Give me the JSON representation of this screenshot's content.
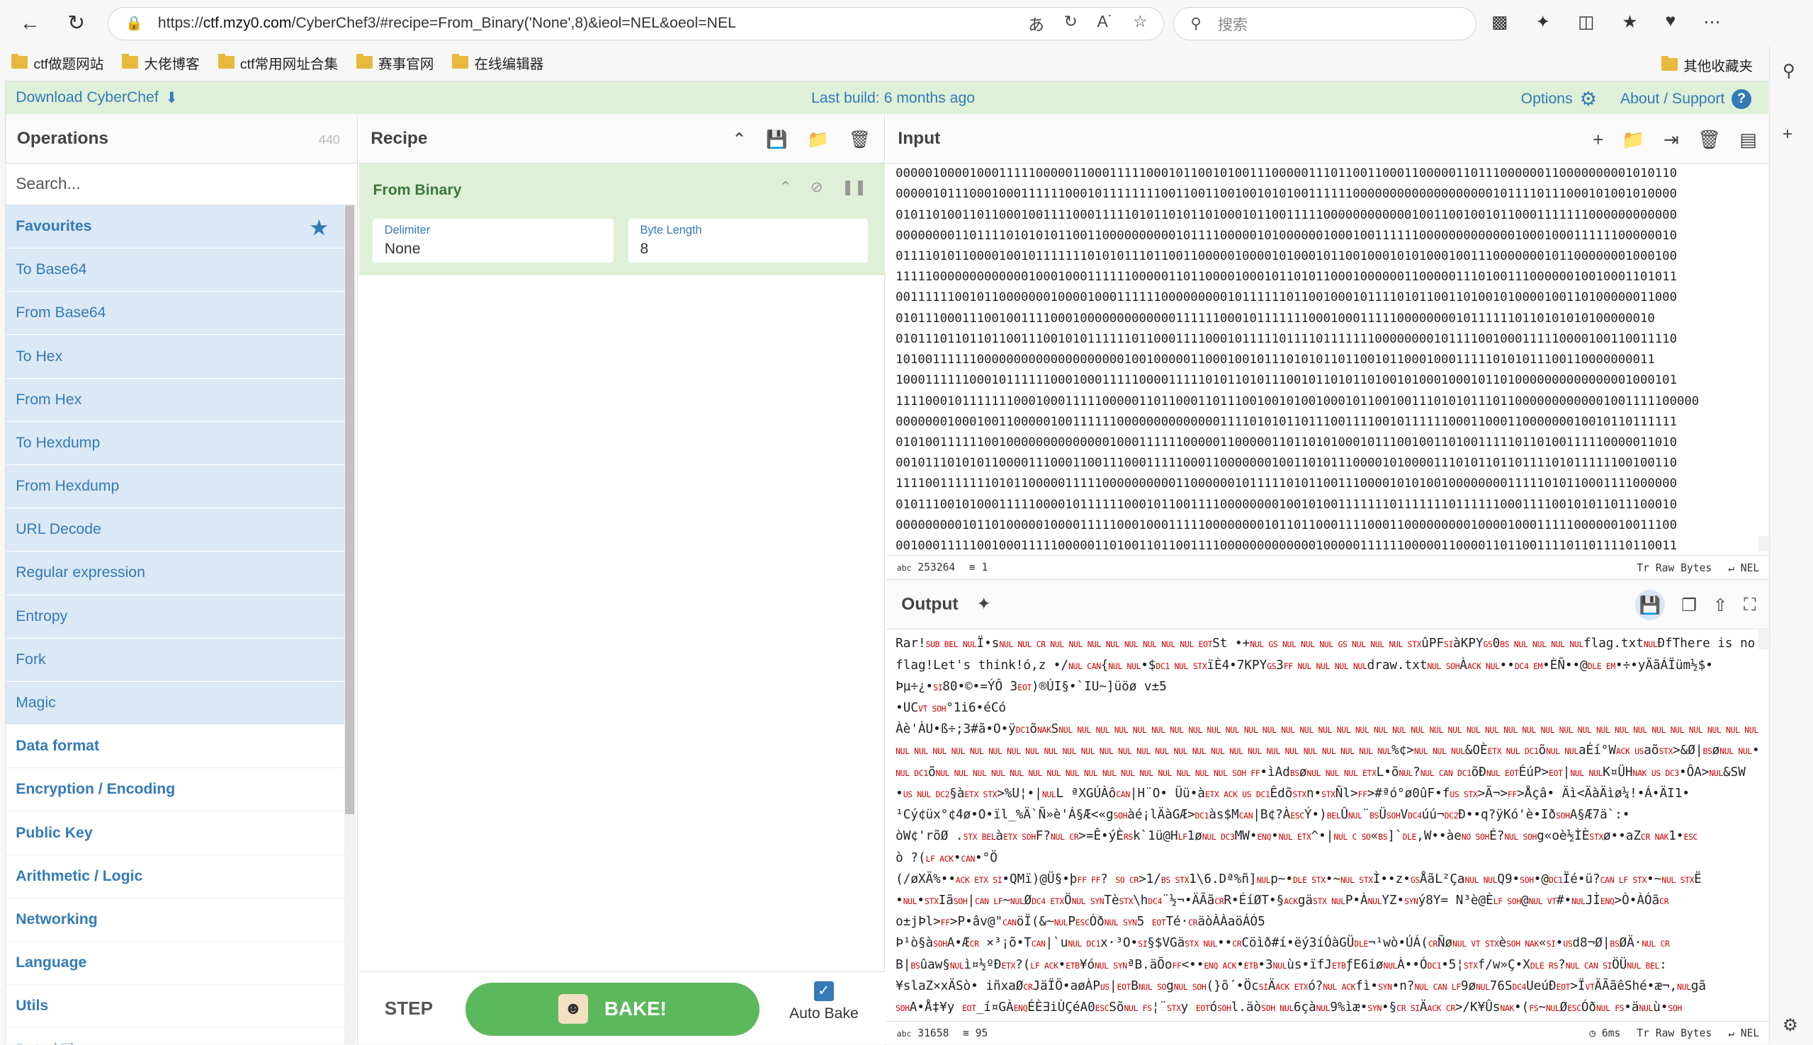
{
  "browser": {
    "url_prefix": "https://",
    "url_host": "ctf.mzy0.com",
    "url_rest": "/CyberChef3/#recipe=From_Binary('None',8)&ieol=NEL&oeol=NEL",
    "search_placeholder": "搜索",
    "bookmarks": [
      "ctf做题网站",
      "大佬博客",
      "ctf常用网址合集",
      "赛事官网",
      "在线编辑器"
    ],
    "other_bookmarks": "其他收藏夹"
  },
  "banner": {
    "download": "Download CyberChef",
    "last_build": "Last build: 6 months ago",
    "options": "Options",
    "about": "About / Support"
  },
  "operations": {
    "title": "Operations",
    "count": "440",
    "search_placeholder": "Search...",
    "favourites": "Favourites",
    "fav_items": [
      "To Base64",
      "From Base64",
      "To Hex",
      "From Hex",
      "To Hexdump",
      "From Hexdump",
      "URL Decode",
      "Regular expression",
      "Entropy",
      "Fork",
      "Magic"
    ],
    "categories": [
      "Data format",
      "Encryption / Encoding",
      "Public Key",
      "Arithmetic / Logic",
      "Networking",
      "Language",
      "Utils",
      "Date / Time"
    ]
  },
  "recipe": {
    "title": "Recipe",
    "op_name": "From Binary",
    "delimiter_label": "Delimiter",
    "delimiter_value": "None",
    "bytelen_label": "Byte Length",
    "bytelen_value": "8",
    "step": "STEP",
    "bake": "BAKE!",
    "autobake": "Auto Bake"
  },
  "input": {
    "title": "Input",
    "lines": [
      "0000010000100011111000001100011111000101100101001110000011101100110001100000110111000000110000000001010110",
      "0000010111000100011111100010111111110011001100100101010011111100000000000000000001011110111000101001010000",
      "0101101001101100010011110001111101011010110100010110011111000000000000100110010010110001111111000000000000",
      "0000000011011110101010110011000000000010111100000101000000100010011111100000000000001000100011111100000010",
      "0111101011000010010111111101010111011001100000100001010001011001000101010001001110000000101100000001000100",
      "1111100000000000001000100011111100000110110000100010110101100010000001100000111010011100000010010001101011",
      "0011111100101100000001000010001111110000000001011111101100100010111101011001101001010000100110100000011000",
      "0101110001110010011110001000000000000011111100010111111100010001111100000000101111110110101010100000010",
      "0101110110110110011100101011111101100011110001011111011110111111100000000101111001000111110000100110011110",
      "1010011111100000000000000000000100100000110001001011101010110110010110001000111110101011100110000000011",
      "1000111111000101111110001000111110000111110101101011100101101011010010100010001011010000000000000001000101",
      "1111000101111111000100011111000001101100011011100100101001000101100100111010101110110000000000001001111100000",
      "0000000100010011000001001111110000000000000011110101011011100111100101111110001100011000000010010110111111",
      "0101001111110010000000000000010001111110000011000001101101010001011100100110100111110110100111110000011010",
      "0010111010101100001110001100111000111110001100000001001101011100001010000111010110110111101011111100100110",
      "1111001111111010110000011111000000000011000000101111101011001110000101010010000000011111010110001111000000",
      "0101110010100011111000010111111000101100111100000000100101001111111011111110111111000111100101011011100010",
      "0000000001011010000010000111110001000111110000000010110110001111000110000000001000010001111100000010011100",
      "0010001111100100011111000001101001101100111100000000000001000001111110000011000011011001111011011110110011"
    ],
    "status_chars": "253264",
    "status_lines": "1",
    "raw_bytes": "Raw Bytes",
    "eol": "NEL"
  },
  "output": {
    "title": "Output",
    "lines": [
      "Rar!⟨SUB BEL NUL⟩Ï•s⟨NUL NUL CR NUL NUL NUL NUL NUL NUL NUL NUL EOT⟩St •+⟨NUL GS NUL NUL NUL GS NUL NUL NUL STX⟩ûPF⟨SI⟩àKPY⟨GS⟩0⟨BS NUL  NUL NUL NUL⟩flag.txt⟨NUL⟩ÐfThere is no",
      "flag!Let's think!ó,z •/⟨NUL CAN⟩{⟨NUL NUL⟩•$⟨DC1 NUL STX⟩ïÈ4•7KPY⟨GS⟩3⟨FF NUL  NUL NUL NUL⟩draw.txt⟨NUL SOH⟩À⟨ACK NUL⟩••⟨DC4 EM⟩•ÈÑ••@⟨DLE EM⟩•÷•yÄãÁÏüm½$•",
      "Þµ÷¿•⟨SI⟩80•©•=ÝÔ 3⟨EOT⟩)®ÚI§•`IU~]üöø   v±5",
      "•UC⟨VT SOH⟩°1i6•éCó",
      "Àè'ÀU•ß÷;3#ã•O•ÿ⟨DC1⟩õ⟨NAK⟩S⟨NUL NUL NUL NUL NUL NUL NUL NUL NUL NUL NUL NUL NUL NUL NUL NUL NUL NUL NUL NUL NUL NUL NUL NUL NUL NUL NUL NUL NUL NUL NUL NUL NUL NUL NUL NUL NUL NUL⟩",
      "⟨NUL NUL NUL NUL NUL NUL NUL NUL NUL NUL NUL NUL NUL NUL NUL NUL NUL NUL NUL NUL NUL NUL NUL NUL NUL NUL NUL⟩%¢>⟨NUL NUL NUL⟩&OÈ⟨ETX NUL DC1⟩õ⟨NUL NUL⟩aÉí°W⟨ACK US⟩aõ⟨STX⟩>&Ø|⟨BS⟩ø⟨NUL NUL⟩•?",
      "⟨NUL DC1⟩õ⟨NUL NUL NUL NUL NUL NUL NUL NUL NUL NUL NUL NUL NUL NUL NUL NUL SOH FF⟩•ìAd⟨BS⟩ø⟨NUL NUL NUL ETX⟩L•õ⟨NUL⟩?⟨NUL CAN DC1⟩õÐ⟨NUL EOT⟩ÉúP>⟨EOT⟩|⟨NUL NUL⟩K¤ÜH⟨NAK US DC3⟩•ÔA>⟨NUL⟩&SW",
      "•⟨US NUL DC2⟩§à⟨ETX STX⟩>%U¦•|⟨NUL⟩L ªXGÚÀô⟨CAN⟩|H¨O•  Üü•à⟨ETX ACK US DC1⟩Êdõ⟨STX⟩n•⟨STX⟩Ñl>⟨FF⟩>#ªó°ø0ûF•f⟨US STX⟩>Ã¬>⟨FF⟩>Åçâ• Äì<ÄàÄìø¼!•Á•ÄI1•",
      "¹Cý¢üx°¢4ø•O•ïl_%Ä`Ñ»è'Á§Æ<«g⟨SOH⟩àé¡lÄàGÆ>⟨DC1⟩às$M⟨CAN⟩|B¢?À⟨ESC⟩Ý•)⟨BEL⟩Û⟨NUL⟩¨⟨BS⟩Ü⟨SOH⟩V⟨DC4⟩úú¬⟨DC2⟩Ð••q?ÿKó'è•Ið⟨SOH⟩A§Æ7ä`:•",
      "òW¢'rõØ .⟨STX BEL⟩à⟨ETX SOH⟩F?⟨NUL CR⟩>=Ê•ýÈ⟨RS⟩k`1ü@H⟨LF⟩1ø⟨NUL DC3⟩MW•⟨ENQ⟩•⟨NUL ETX⟩^•|⟨NUL C SO⟩«⟨BS⟩]`⟨DLE⟩,W••àe⟨NO SOH⟩É?⟨NUL SOH⟩g«oè½ÌÈ⟨STX⟩ø••aZ⟨CR NAK⟩1•⟨ESC⟩",
      "ò   ?(⟨LF ACK⟩•⟨CAN⟩•°Ö",
      "(/øXÄ%••⟨ACK ETX SI⟩•QMï)@Ü§•þ⟨FF FF⟩?  ⟨SO CR⟩>1/⟨BS STX⟩1\\6.Dª%ñ]⟨NUL⟩p~•⟨DLE STX⟩•~⟨NUL STX⟩Ì••z•⟨GS⟩ÅãL²Ça⟨NUL NUL⟩Q9•⟨SOH⟩•@⟨DC1⟩Ïé•ü?⟨CAN LF STX⟩•~⟨NUL STX⟩Ë",
      "•⟨NUL⟩•⟨STX⟩Iã⟨SOH⟩|⟨CAN LF⟩~⟨NUL⟩Ø⟨DC4 ETX⟩Ö⟨NUL SYN⟩Tè⟨STX⟩\\h⟨DC4⟩¨½¬•ÄÃã⟨CR⟩R•ÉíØT•§⟨ACK⟩gä⟨STX NUL⟩P•À⟨NUL⟩YZ•⟨SYN⟩ý8Y= N³è@È⟨LF SOH⟩@⟨NUL VT⟩#•⟨NUL⟩JÌ⟨ENQ⟩>Ò•ÀÓã⟨CR⟩",
      "o±jÞl>⟨FF⟩>P•âv@\"⟨CAN⟩öÏ(&~⟨NUL⟩P⟨ESC⟩Óð⟨NUL SYN⟩5  ⟨EOT⟩Té·⟨CR⟩äòÀÀaöÁÓ5",
      "Þ¹ò§à⟨SOH⟩A•Æ⟨CR⟩  ×³¡õ•T⟨CAN⟩|`u⟨NUL DC1⟩x·³O•⟨SI⟩§$VGä⟨STX NUL⟩••⟨CR⟩Cöìð#í•ëý3íÓàGÜ⟨DLE⟩¬¹wò•ÚÁ(⟨CR⟩Ñø⟨NUL VT STX⟩è⟨SOH NAK⟩«⟨SI⟩•⟨US⟩d8¬Ø|⟨BS⟩ØÄ·⟨NUL CR⟩",
      "B|⟨BS⟩ûaw§⟨NUL⟩ì¤½ºÐ⟨ETX⟩?(⟨LF ACK⟩•⟨ETB⟩¥ó⟨NUL SYN⟩ªB.äÕo⟨FF⟩<••⟨ENQ ACK⟩•⟨ETB⟩•3⟨NUL⟩ùs•ïfJ⟨ETB⟩ƒE6iø⟨NUL⟩À••Ó⟨DC1⟩•5¦⟨STX⟩f/w»Ç•X⟨DLE RS⟩?⟨NUL CAN SI⟩ÖÜ⟨NUL BEL⟩:",
      "¥slaZ×xÄSò• iñxaØ⟨CR⟩JäÏÖ•aøÀP⟨US⟩|⟨EOT⟩B⟨NUL SO⟩g⟨NUL SOH⟩(}õ´•Öc⟨SI⟩Ä⟨ACK ETX⟩ó?⟨NUL ACK⟩fì•⟨SYN⟩•n?⟨NUL CAN LF⟩9ø⟨NUL⟩76S⟨DC4⟩UeúÐ⟨EOT⟩>Ï⟨VT⟩ÄÃãêShé•æ¬,⟨NUL⟩gã",
      "⟨SOH⟩A•Å‡¥y ⟨EOT⟩_í¤GÀ⟨ENQ⟩ÉÈ∃iÙÇéA0⟨ESC⟩Sõ⟨NUL FS⟩¦¨⟨STX⟩y ⟨EOT⟩ó⟨SOH⟩l.äò⟨SOH NUL⟩6çà⟨NUL⟩9%ìæ•⟨SYN⟩•§⟨CR SI⟩Ä⟨ACK CR⟩>/K¥Ûs⟨NAK⟩•(⟨FS⟩~⟨NUL⟩Ø⟨ESC⟩Óð⟨NUL FS⟩•ä⟨NUL⟩ù•⟨SOH⟩"
    ],
    "status_chars": "31658",
    "status_lines": "95",
    "time": "6ms",
    "raw_bytes": "Raw Bytes",
    "eol": "NEL"
  }
}
